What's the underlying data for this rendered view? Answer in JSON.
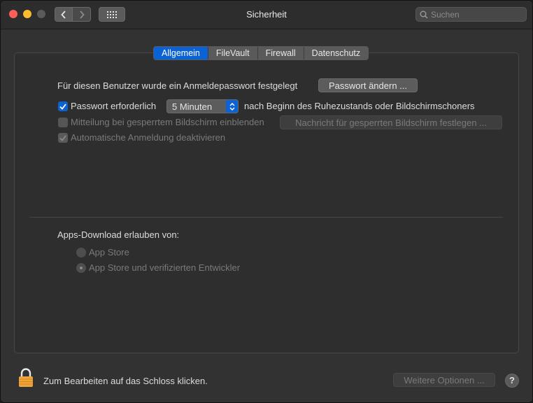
{
  "window": {
    "title": "Sicherheit"
  },
  "search": {
    "placeholder": "Suchen"
  },
  "tabs": [
    {
      "label": "Allgemein",
      "active": true
    },
    {
      "label": "FileVault",
      "active": false
    },
    {
      "label": "Firewall",
      "active": false
    },
    {
      "label": "Datenschutz",
      "active": false
    }
  ],
  "general": {
    "password_set_text": "Für diesen Benutzer wurde ein Anmeldepasswort festgelegt",
    "change_password_button": "Passwort ändern ...",
    "require_password": {
      "label": "Passwort erforderlich",
      "checked": true
    },
    "require_password_delay": "5 Minuten",
    "require_password_suffix": "nach Beginn des Ruhezustands oder Bildschirmschoners",
    "show_message": {
      "label": "Mitteilung bei gesperrtem Bildschirm einblenden",
      "checked": false,
      "enabled": false
    },
    "set_message_button": "Nachricht für gesperrten Bildschirm festlegen ...",
    "disable_auto_login": {
      "label": "Automatische Anmeldung deaktivieren",
      "checked": true,
      "enabled": false
    }
  },
  "apps_download": {
    "heading": "Apps-Download erlauben von:",
    "options": [
      {
        "label": "App Store",
        "selected": false
      },
      {
        "label": "App Store und verifizierten Entwickler",
        "selected": true
      }
    ]
  },
  "footer": {
    "lock_text": "Zum Bearbeiten auf das Schloss klicken.",
    "advanced_button": "Weitere Optionen ...",
    "help_label": "?"
  },
  "colors": {
    "accent": "#0a63d6",
    "lock": "#f0a53a"
  }
}
